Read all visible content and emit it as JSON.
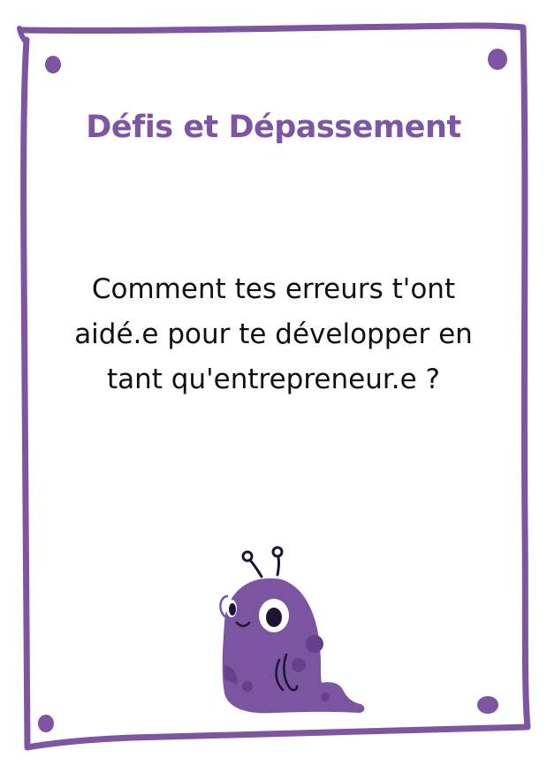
{
  "card": {
    "title": "Défis et Dépassement",
    "question": "Comment tes erreurs t'ont aidé.e pour te développer en tant qu'entrepreneur.e ?"
  },
  "colors": {
    "accent": "#7d55a3",
    "monster_body": "#7b55a0",
    "monster_spots": "#65418a",
    "outline": "#1b1433",
    "text": "#111111",
    "background": "#ffffff"
  },
  "icons": {
    "illustration": "purple-monster-icon"
  }
}
